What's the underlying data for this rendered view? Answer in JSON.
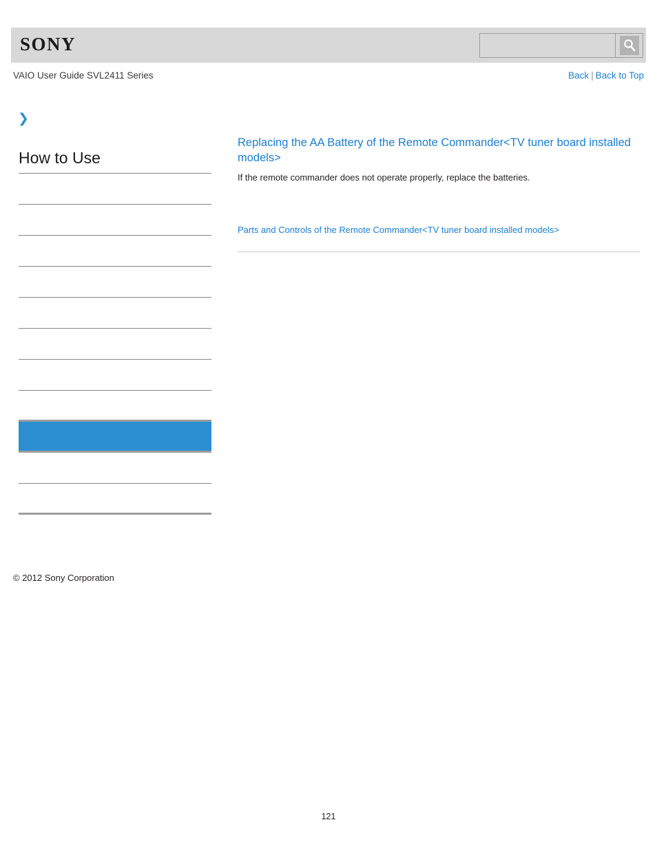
{
  "header": {
    "logo_text": "SONY",
    "search": {
      "value": "",
      "placeholder": "",
      "icon": "search-icon"
    }
  },
  "breadcrumb": {
    "guide_title": "VAIO User Guide SVL2411 Series",
    "back_label": "Back",
    "separator": "|",
    "back_to_top_label": "Back to Top"
  },
  "sidebar": {
    "chevron_icon": "chevron-right-icon",
    "heading": "How to Use",
    "items": [
      {
        "label": "",
        "state": "normal"
      },
      {
        "label": "",
        "state": "normal"
      },
      {
        "label": "",
        "state": "normal"
      },
      {
        "label": "",
        "state": "normal"
      },
      {
        "label": "",
        "state": "normal"
      },
      {
        "label": "",
        "state": "normal"
      },
      {
        "label": "",
        "state": "normal"
      },
      {
        "label": "",
        "state": "thick"
      },
      {
        "label": "",
        "state": "selected"
      },
      {
        "label": "",
        "state": "normal"
      },
      {
        "label": "",
        "state": "thick"
      }
    ]
  },
  "main": {
    "title": "Replacing the AA Battery of the Remote Commander<TV tuner board installed models>",
    "body": "If the remote commander does not operate properly, replace the batteries.",
    "related_link": "Parts and Controls of the Remote Commander<TV tuner board installed models>"
  },
  "footer": {
    "copyright": "© 2012 Sony Corporation",
    "page_number": "121"
  },
  "colors": {
    "link": "#1b7fd4",
    "accent": "#2b8fd0",
    "header_band": "#d8d8d8",
    "rule": "#868686"
  }
}
